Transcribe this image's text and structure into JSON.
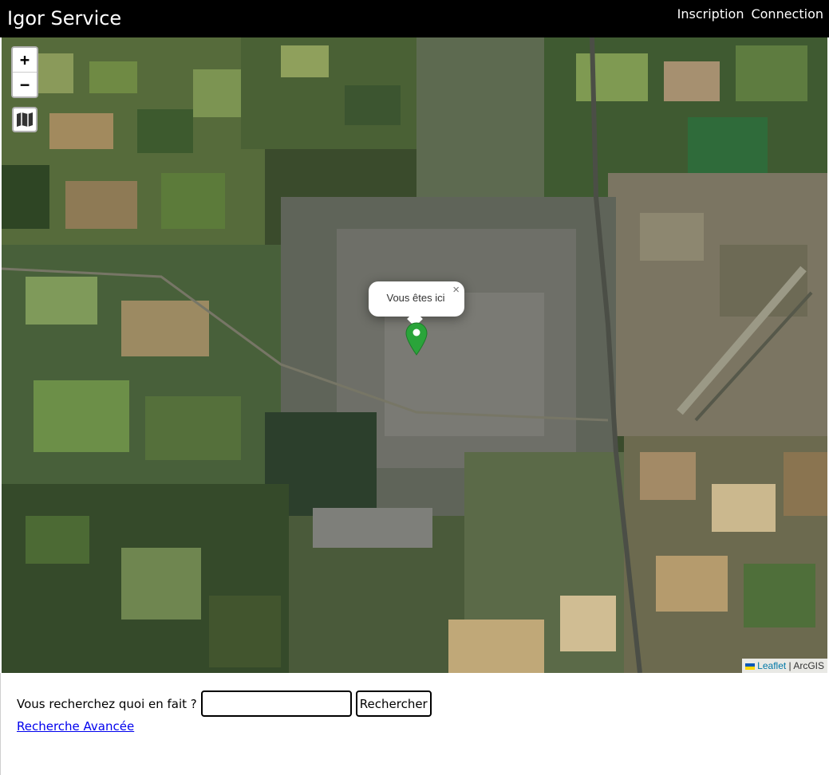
{
  "header": {
    "brand": "Igor Service",
    "nav": [
      {
        "label": "Inscription"
      },
      {
        "label": "Connection"
      }
    ]
  },
  "map": {
    "zoom_in_label": "+",
    "zoom_out_label": "−",
    "layers_icon": "map-layers-icon",
    "popup_text": "Vous êtes ici",
    "popup_close": "×",
    "marker_color": "#2aa43a",
    "attribution": {
      "link": "Leaflet",
      "separator": " | ",
      "provider": "ArcGIS"
    }
  },
  "search": {
    "label": "Vous recherchez quoi en fait ?",
    "input_value": "",
    "button_label": "Rechercher",
    "advanced_link": "Recherche Avancée"
  },
  "colors": {
    "header_bg": "#000000",
    "link": "#0000ee",
    "leaflet_link": "#0078a8"
  }
}
